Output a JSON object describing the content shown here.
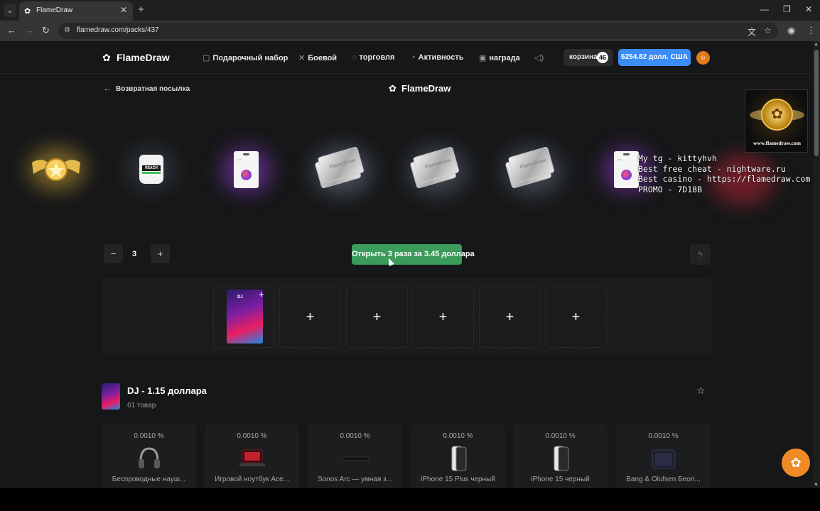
{
  "browser": {
    "tab_title": "FlameDraw",
    "url": "flamedraw.com/packs/437"
  },
  "header": {
    "logo": "FlameDraw",
    "nav": [
      "Подарочный набор",
      "Боевой",
      "торговля",
      "Активность",
      "награда"
    ],
    "cart_label": "корзина",
    "cart_count": "46",
    "balance": "6254.82 долл. США"
  },
  "page": {
    "back_label": "Возвратная посылка",
    "center_logo": "FlameDraw"
  },
  "overlay": {
    "lines": "My tg - kittyhvh\nBest free cheat - nightware.ru\nBest casino - https://flamedraw.com\nPROMO - 7D18B",
    "logo_url": "www.flamedraw.com"
  },
  "controls": {
    "quantity": "3",
    "minus": "−",
    "plus": "+",
    "open_label": "Открыть 3 раза за 3.45 доллара",
    "slot_plus": "+"
  },
  "pack": {
    "title": "DJ - 1.15 доллара",
    "count": "61 товар",
    "pack_badge": "DJ"
  },
  "items": [
    {
      "pct": "0.0010 %",
      "name": "Беспроводные науш..."
    },
    {
      "pct": "0.0010 %",
      "name": "Игровой ноутбук Ace..."
    },
    {
      "pct": "0.0010 %",
      "name": "Sonos Arc — умная з..."
    },
    {
      "pct": "0.0010 %",
      "name": "iPhone 15 Plus черный"
    },
    {
      "pct": "0.0010 %",
      "name": "iPhone 15 черный"
    },
    {
      "pct": "0.0010 %",
      "name": "Bang & Olufsen Беол..."
    }
  ],
  "reel": {
    "floss_label": "REACH",
    "ticket_label": "FlameDraw"
  },
  "colors": {
    "open_button": "#3b9b5a",
    "balance_button": "#3b8cf5",
    "fab": "#f08a24"
  }
}
